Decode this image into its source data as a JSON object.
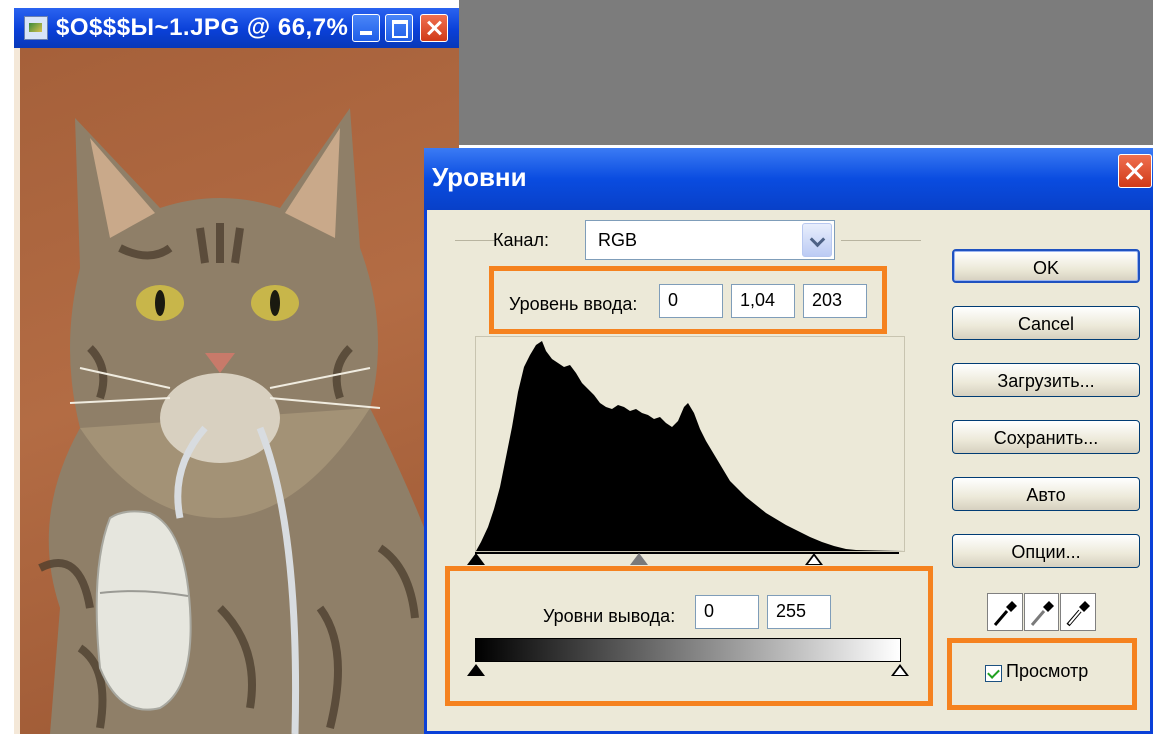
{
  "doc_window": {
    "title": "$O$$$Ы~1.JPG @ 66,7% ..."
  },
  "dialog": {
    "title": "Уровни",
    "channel_label": "Канал:",
    "channel_value": "RGB",
    "input_levels_label": "Уровень ввода:",
    "input_black": "0",
    "input_gamma": "1,04",
    "input_white": "203",
    "output_levels_label": "Уровни вывода:",
    "output_black": "0",
    "output_white": "255",
    "buttons": {
      "ok": "OK",
      "cancel": "Cancel",
      "load": "Загрузить...",
      "save": "Сохранить...",
      "auto": "Авто",
      "options": "Опции..."
    },
    "preview_label": "Просмотр",
    "preview_checked": true
  },
  "colors": {
    "highlight": "#f5821f",
    "titlebar": "#0a4ce0",
    "dialog_bg": "#ece9d8"
  }
}
